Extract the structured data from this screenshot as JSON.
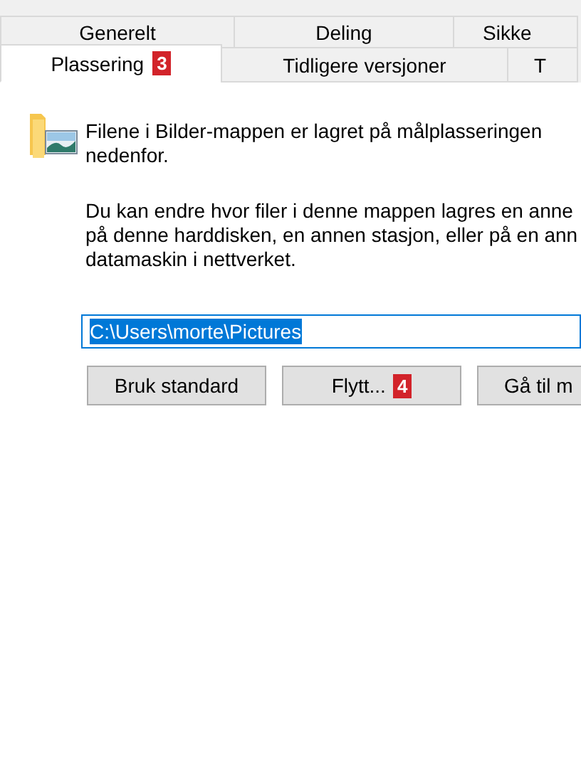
{
  "tabs_back": [
    {
      "label": "Generelt",
      "selected": false
    },
    {
      "label": "Deling",
      "selected": false
    },
    {
      "label": "Sikke",
      "selected": false
    }
  ],
  "tabs_front": [
    {
      "label": "Plassering",
      "selected": true,
      "badge": "3"
    },
    {
      "label": "Tidligere versjoner",
      "selected": false
    },
    {
      "label": "T",
      "selected": false
    }
  ],
  "intro": [
    "Filene i Bilder-mappen er lagret på målplasseringen",
    "nedenfor."
  ],
  "description": [
    "Du kan endre hvor filer i denne mappen lagres en anne",
    "på denne harddisken, en annen stasjon, eller på en ann",
    "datamaskin i nettverket."
  ],
  "location_field": {
    "value": "C:\\Users\\morte\\Pictures",
    "text_selected": true
  },
  "buttons": [
    {
      "label": "Bruk standard"
    },
    {
      "label": "Flytt...",
      "badge": "4"
    },
    {
      "label": "Gå til m"
    }
  ]
}
